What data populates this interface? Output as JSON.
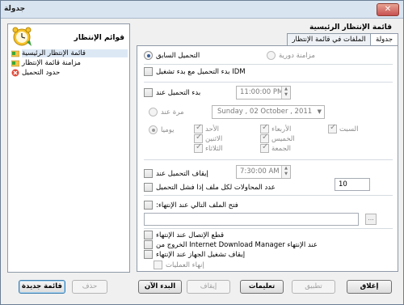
{
  "window": {
    "title": "جدولة",
    "close_glyph": "✕"
  },
  "sidebar": {
    "header": "قوائم الإنتظار",
    "items": [
      {
        "label": "قائمة الإنتظار الرئيسية",
        "icon": "queue-folder-icon"
      },
      {
        "label": "مزامنة قائمة الإنتظار",
        "icon": "sync-folder-icon"
      },
      {
        "label": "حدود التحميل",
        "icon": "limits-x-icon"
      }
    ]
  },
  "main": {
    "title": "قائمة الإنتظار الرئيسية",
    "tabs": [
      {
        "label": "جدولة",
        "active": true
      },
      {
        "label": "الملفات في قائمة الإنتظار",
        "active": false
      }
    ]
  },
  "schedule": {
    "once_previous": "التحميل السابق",
    "periodic_sync": "مزامنة دورية",
    "start_with_idm": "بدء التحميل مع بدء تشغيل IDM",
    "start_at": "بدء التحميل عند",
    "start_time": "11:00:00 PM",
    "once_at": "مرة عند",
    "once_date": "Sunday   , 02   October  , 2011",
    "daily": "يوميا",
    "days": {
      "sat": "السبت",
      "sun": "الأحد",
      "mon": "الاثنين",
      "tue": "الثلاثاء",
      "wed": "الأربعاء",
      "thu": "الخميس",
      "fri": "الجمعة"
    },
    "stop_at": "إيقاف التحميل عند",
    "stop_time": "7:30:00 AM",
    "retries_label": "عدد المحاولات لكل ملف إذا فشل التحميل",
    "retries_value": "10",
    "open_file_on_done": "فتح الملف التالي عند الإنتهاء:",
    "open_file_path": "",
    "browse_label": "...",
    "hangup": "قطع الإتصال عند الإنتهاء",
    "exit_idm": "الخروج من Internet Download Manager عند الإنتهاء",
    "shutdown": "إيقاف تشغيل الجهاز عند الإنتهاء",
    "terminate_processes": "إنهاء العمليات"
  },
  "buttons": {
    "new_queue": "قائمة جديدة",
    "delete": "حذف",
    "start_now": "البدء الآن",
    "stop": "إيقاف",
    "help": "تعليمات",
    "apply": "تطبيق",
    "close": "إغلاق"
  }
}
